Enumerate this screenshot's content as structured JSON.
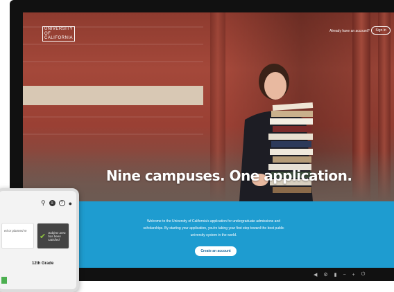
{
  "header": {
    "logo_lines": [
      "UNIVERSITY",
      "OF",
      "CALIFORNIA"
    ],
    "account_prompt": "Already have an account?",
    "signin_label": "Sign in"
  },
  "hero": {
    "headline": "Nine campuses. One application."
  },
  "welcome": {
    "text": "Welcome to the University of California's application for undergraduate admissions and scholarships. By starting your application, you're taking your first step toward the best public university system in the world.",
    "create_label": "Create an account"
  },
  "tablet": {
    "card_left_text": "ed or planned m",
    "card_right_text": "Subject area has been satisfied",
    "grade_label": "12th Grade",
    "icons": [
      "search-icon",
      "list-icon",
      "help-icon",
      "user-icon"
    ]
  },
  "taskbar": {
    "icons": [
      "speaker-icon",
      "settings-icon",
      "trash-icon",
      "minus-icon",
      "plus-icon",
      "power-icon"
    ]
  },
  "colors": {
    "accent": "#1e9cd0",
    "check": "#8fc33f"
  }
}
